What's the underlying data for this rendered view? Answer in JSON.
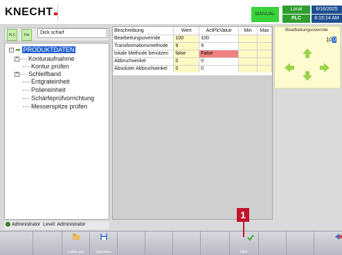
{
  "header": {
    "logo": "KNECHT",
    "mode": "MANUAL",
    "location": "Local",
    "plc": "PLC",
    "date": "6/16/2025",
    "time": "8:15:14 AM"
  },
  "left_top": {
    "plc_button": "PLC",
    "file_button": "File",
    "file_name": "Dick scharf"
  },
  "tree": {
    "root_label": "PRODUKTDATEN",
    "items": [
      {
        "label": "Konturaufnahme",
        "expandable": true
      },
      {
        "label": "Kontur prüfen",
        "expandable": false
      },
      {
        "label": "Schleifband",
        "expandable": true
      },
      {
        "label": "Entgrateinheit",
        "expandable": false
      },
      {
        "label": "Poliereinheit",
        "expandable": false
      },
      {
        "label": "Schärfeprüfvorrichtung",
        "expandable": false
      },
      {
        "label": "Messerspitze prüfen",
        "expandable": false
      }
    ]
  },
  "table": {
    "headers": [
      "Beschreibung",
      "Wert",
      "ActPlcValue",
      "Min",
      "Max"
    ],
    "rows": [
      {
        "desc": "Bearbeitungsoverride",
        "wert": "100",
        "act": "100",
        "min": "",
        "max": ""
      },
      {
        "desc": "Transformationsmethode",
        "wert": "9",
        "act": "9",
        "min": "",
        "max": ""
      },
      {
        "desc": "lokale Methode benutzen",
        "wert": "false",
        "act": "False",
        "min": "",
        "max": ""
      },
      {
        "desc": "Abbruchwinkel",
        "wert": "0",
        "act": "0",
        "min": "",
        "max": ""
      },
      {
        "desc": "Absoluter Abbruchwinkel",
        "wert": "0",
        "act": "0",
        "min": "",
        "max": ""
      }
    ]
  },
  "override": {
    "title": "Bearbeitungsoverride",
    "value_prefix": "10",
    "value_highlight": "0"
  },
  "status": {
    "user": "Administrator",
    "level_label": "Level: Administrator"
  },
  "toolbar": {
    "load": "Laden aus",
    "save": "Speichern",
    "apply": "Über"
  },
  "marker": "1",
  "colors": {
    "mode_green": "#3bd33b",
    "plc_green": "#2f9e2f",
    "datetime_blue": "#1f4f8f",
    "error_red": "#f08080",
    "cell_yellow": "#fff9c4",
    "marker_red": "#c0142a"
  }
}
